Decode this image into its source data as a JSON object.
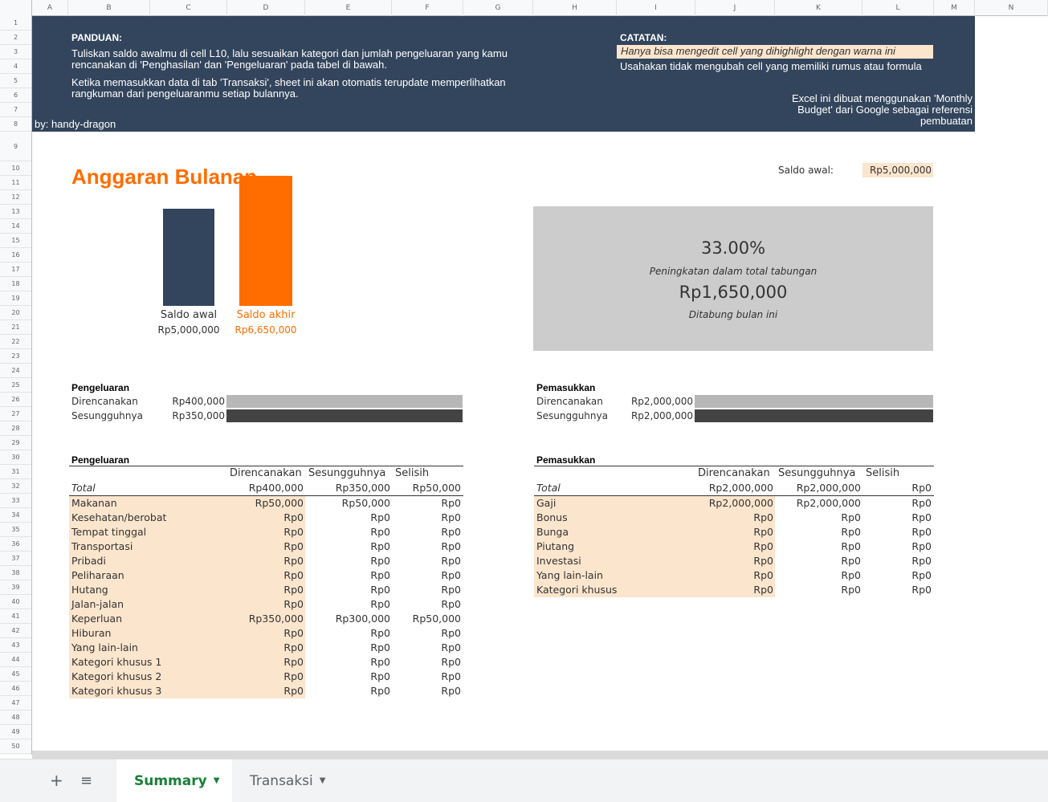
{
  "columns": [
    "A",
    "B",
    "C",
    "D",
    "E",
    "F",
    "G",
    "H",
    "I",
    "J",
    "K",
    "L",
    "M",
    "N"
  ],
  "banner": {
    "guide_title": "PANDUAN:",
    "guide_line1": "Tuliskan saldo awalmu di cell L10, lalu sesuaikan kategori dan jumlah pengeluaran yang kamu",
    "guide_line2": "rencanakan di 'Penghasilan' dan 'Pengeluaran' pada tabel di bawah.",
    "guide_line3": "Ketika memasukkan data di tab 'Transaksi', sheet ini akan otomatis terupdate memperlihatkan",
    "guide_line4": "rangkuman dari pengeluaranmu setiap bulannya.",
    "author": "by: handy-dragon",
    "note_title": "CATATAN:",
    "note_highlight": "Hanya bisa mengedit cell yang dihighlight dengan warna ini",
    "note_formula": "Usahakan tidak mengubah cell yang memiliki rumus atau formula",
    "credit1": "Excel ini dibuat menggunakan 'Monthly",
    "credit2": "Budget' dari Google sebagai referensi",
    "credit3": "pembuatan"
  },
  "title": "Anggaran Bulanan",
  "start_balance": {
    "label": "Saldo awal:",
    "value": "Rp5,000,000"
  },
  "chart_data": {
    "type": "bar",
    "categories": [
      "Saldo awal",
      "Saldo akhir"
    ],
    "values": [
      5000000,
      6650000
    ],
    "value_labels": [
      "Rp5,000,000",
      "Rp6,650,000"
    ],
    "colors": [
      "#33455c",
      "#ff6d01"
    ],
    "ylim": [
      0,
      7000000
    ]
  },
  "summary": {
    "percent": "33.00%",
    "percent_caption": "Peningkatan dalam total tabungan",
    "saved": "Rp1,650,000",
    "saved_caption": "Ditabung bulan ini"
  },
  "expense_bars": {
    "title": "Pengeluaran",
    "planned_label": "Direncanakan",
    "planned_value": "Rp400,000",
    "planned_fraction": 1.0,
    "actual_label": "Sesungguhnya",
    "actual_value": "Rp350,000",
    "actual_fraction": 1.0
  },
  "income_bars": {
    "title": "Pemasukkan",
    "planned_label": "Direncanakan",
    "planned_value": "Rp2,000,000",
    "planned_fraction": 1.0,
    "actual_label": "Sesungguhnya",
    "actual_value": "Rp2,000,000",
    "actual_fraction": 1.0
  },
  "expense_table": {
    "title": "Pengeluaran",
    "headers": [
      "Direncanakan",
      "Sesungguhnya",
      "Selisih"
    ],
    "total": [
      "Total",
      "Rp400,000",
      "Rp350,000",
      "Rp50,000"
    ],
    "rows": [
      [
        "Makanan",
        "Rp50,000",
        "Rp50,000",
        "Rp0"
      ],
      [
        "Kesehatan/berobat",
        "Rp0",
        "Rp0",
        "Rp0"
      ],
      [
        "Tempat tinggal",
        "Rp0",
        "Rp0",
        "Rp0"
      ],
      [
        "Transportasi",
        "Rp0",
        "Rp0",
        "Rp0"
      ],
      [
        "Pribadi",
        "Rp0",
        "Rp0",
        "Rp0"
      ],
      [
        "Peliharaan",
        "Rp0",
        "Rp0",
        "Rp0"
      ],
      [
        "Hutang",
        "Rp0",
        "Rp0",
        "Rp0"
      ],
      [
        "Jalan-jalan",
        "Rp0",
        "Rp0",
        "Rp0"
      ],
      [
        "Keperluan",
        "Rp350,000",
        "Rp300,000",
        "Rp50,000"
      ],
      [
        "Hiburan",
        "Rp0",
        "Rp0",
        "Rp0"
      ],
      [
        "Yang lain-lain",
        "Rp0",
        "Rp0",
        "Rp0"
      ],
      [
        "Kategori khusus 1",
        "Rp0",
        "Rp0",
        "Rp0"
      ],
      [
        "Kategori khusus 2",
        "Rp0",
        "Rp0",
        "Rp0"
      ],
      [
        "Kategori khusus 3",
        "Rp0",
        "Rp0",
        "Rp0"
      ]
    ]
  },
  "income_table": {
    "title": "Pemasukkan",
    "headers": [
      "Direncanakan",
      "Sesungguhnya",
      "Selisih"
    ],
    "total": [
      "Total",
      "Rp2,000,000",
      "Rp2,000,000",
      "Rp0"
    ],
    "rows": [
      [
        "Gaji",
        "Rp2,000,000",
        "Rp2,000,000",
        "Rp0"
      ],
      [
        "Bonus",
        "Rp0",
        "Rp0",
        "Rp0"
      ],
      [
        "Bunga",
        "Rp0",
        "Rp0",
        "Rp0"
      ],
      [
        "Piutang",
        "Rp0",
        "Rp0",
        "Rp0"
      ],
      [
        "Investasi",
        "Rp0",
        "Rp0",
        "Rp0"
      ],
      [
        "Yang lain-lain",
        "Rp0",
        "Rp0",
        "Rp0"
      ],
      [
        "Kategori khusus",
        "Rp0",
        "Rp0",
        "Rp0"
      ]
    ]
  },
  "tabs": [
    {
      "label": "Summary",
      "active": true
    },
    {
      "label": "Transaksi",
      "active": false
    }
  ],
  "toolbar": {
    "add_icon": "plus-icon",
    "list_icon": "sheet-list-icon"
  },
  "colors": {
    "banner": "#33455c",
    "accent": "#ff6d01",
    "editable": "#fce5cd",
    "summary_box": "#cccccc"
  }
}
